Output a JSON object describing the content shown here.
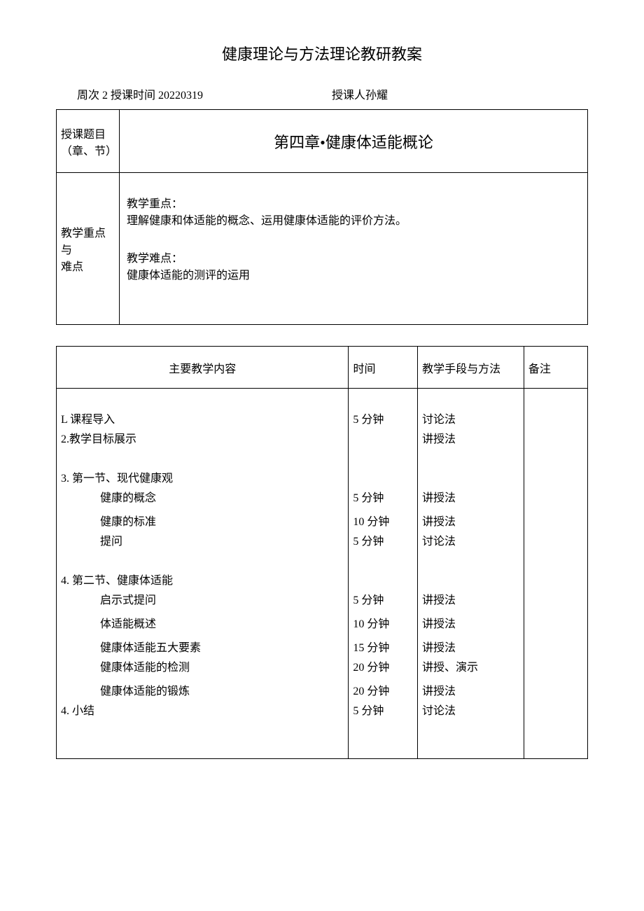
{
  "title": "健康理论与方法理论教研教案",
  "meta": {
    "week_label": "周次 2 授课时间 20220319",
    "instructor_label": "授课人孙耀"
  },
  "table1": {
    "row1_label_a": "授课题目",
    "row1_label_b": "（章、节）",
    "topic": "第四章•健康体适能概论",
    "row2_label_a": "教学重点与",
    "row2_label_b": "难点",
    "focus_heading": "教学重点：",
    "focus_text": "理解健康和体适能的概念、运用健康体适能的评价方法。",
    "difficulty_heading": "教学难点：",
    "difficulty_text": "健康体适能的测评的运用"
  },
  "table2": {
    "headers": {
      "content": "主要教学内容",
      "time": "时间",
      "method": "教学手段与方法",
      "note": "备注"
    },
    "rows": [
      {
        "c": "L 课程导入",
        "t": "5 分钟",
        "m": "讨论法",
        "indent": 0
      },
      {
        "c": "2.教学目标展示",
        "t": "",
        "m": "讲授法",
        "indent": 0
      },
      {
        "spacer": "lg"
      },
      {
        "c": "3. 第一节、现代健康观",
        "t": "",
        "m": "",
        "indent": 0
      },
      {
        "c": "健康的概念",
        "t": "5 分钟",
        "m": "讲授法",
        "indent": 2
      },
      {
        "spacer": "sm"
      },
      {
        "c": "健康的标准",
        "t": "10 分钟",
        "m": "讲授法",
        "indent": 2
      },
      {
        "c": "提问",
        "t": "5 分钟",
        "m": "讨论法",
        "indent": 2
      },
      {
        "spacer": "lg"
      },
      {
        "c": "4. 第二节、健康体适能",
        "t": "",
        "m": "",
        "indent": 0
      },
      {
        "c": "启示式提问",
        "t": "5 分钟",
        "m": "讲授法",
        "indent": 2
      },
      {
        "spacer": "sm"
      },
      {
        "c": "体适能概述",
        "t": "10 分钟",
        "m": "讲授法",
        "indent": 2
      },
      {
        "spacer": "sm"
      },
      {
        "c": "健康体适能五大要素",
        "t": "15 分钟",
        "m": "讲授法",
        "indent": 2
      },
      {
        "c": "健康体适能的检测",
        "t": "20 分钟",
        "m": "讲授、演示",
        "indent": 2
      },
      {
        "spacer": "sm"
      },
      {
        "c": "健康体适能的锻炼",
        "t": "20 分钟",
        "m": "讲授法",
        "indent": 2
      },
      {
        "c": "4. 小结",
        "t": "5 分钟",
        "m": "讨论法",
        "indent": 0
      },
      {
        "spacer": "lg"
      },
      {
        "spacer": "lg"
      }
    ]
  }
}
